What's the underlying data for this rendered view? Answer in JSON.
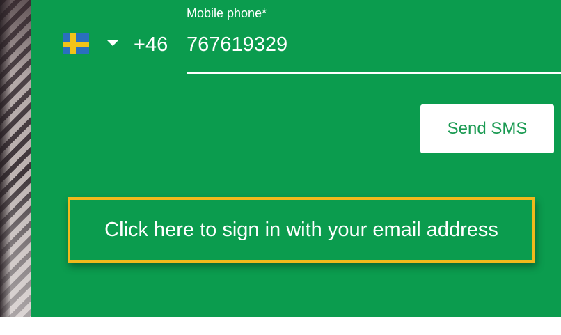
{
  "phone": {
    "country_flag_icon": "sweden-flag-icon",
    "country_dropdown_icon": "chevron-down-icon",
    "dial_code": "+46",
    "label": "Mobile phone*",
    "value": "767619329"
  },
  "actions": {
    "send_sms_label": "Send SMS",
    "email_signin_label": "Click here to sign in with your email address"
  },
  "colors": {
    "panel_green": "#0b9c4e",
    "highlight_border": "#f0b91c",
    "button_text": "#1a9a52",
    "flag_blue": "#2a6fbf",
    "flag_yellow": "#f2c318"
  }
}
